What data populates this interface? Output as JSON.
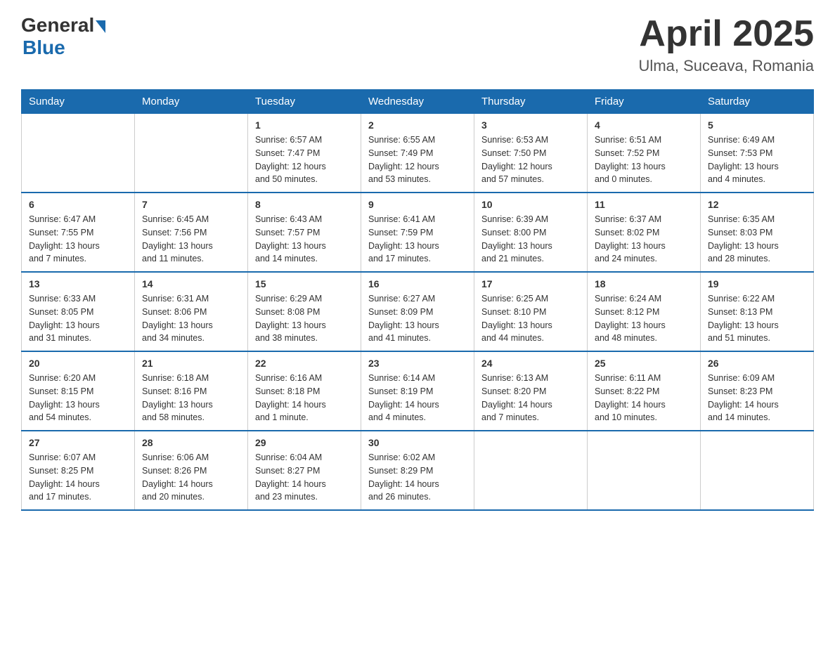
{
  "logo": {
    "general": "General",
    "blue": "Blue"
  },
  "title": "April 2025",
  "location": "Ulma, Suceava, Romania",
  "days_header": [
    "Sunday",
    "Monday",
    "Tuesday",
    "Wednesday",
    "Thursday",
    "Friday",
    "Saturday"
  ],
  "weeks": [
    [
      {
        "num": "",
        "info": ""
      },
      {
        "num": "",
        "info": ""
      },
      {
        "num": "1",
        "info": "Sunrise: 6:57 AM\nSunset: 7:47 PM\nDaylight: 12 hours\nand 50 minutes."
      },
      {
        "num": "2",
        "info": "Sunrise: 6:55 AM\nSunset: 7:49 PM\nDaylight: 12 hours\nand 53 minutes."
      },
      {
        "num": "3",
        "info": "Sunrise: 6:53 AM\nSunset: 7:50 PM\nDaylight: 12 hours\nand 57 minutes."
      },
      {
        "num": "4",
        "info": "Sunrise: 6:51 AM\nSunset: 7:52 PM\nDaylight: 13 hours\nand 0 minutes."
      },
      {
        "num": "5",
        "info": "Sunrise: 6:49 AM\nSunset: 7:53 PM\nDaylight: 13 hours\nand 4 minutes."
      }
    ],
    [
      {
        "num": "6",
        "info": "Sunrise: 6:47 AM\nSunset: 7:55 PM\nDaylight: 13 hours\nand 7 minutes."
      },
      {
        "num": "7",
        "info": "Sunrise: 6:45 AM\nSunset: 7:56 PM\nDaylight: 13 hours\nand 11 minutes."
      },
      {
        "num": "8",
        "info": "Sunrise: 6:43 AM\nSunset: 7:57 PM\nDaylight: 13 hours\nand 14 minutes."
      },
      {
        "num": "9",
        "info": "Sunrise: 6:41 AM\nSunset: 7:59 PM\nDaylight: 13 hours\nand 17 minutes."
      },
      {
        "num": "10",
        "info": "Sunrise: 6:39 AM\nSunset: 8:00 PM\nDaylight: 13 hours\nand 21 minutes."
      },
      {
        "num": "11",
        "info": "Sunrise: 6:37 AM\nSunset: 8:02 PM\nDaylight: 13 hours\nand 24 minutes."
      },
      {
        "num": "12",
        "info": "Sunrise: 6:35 AM\nSunset: 8:03 PM\nDaylight: 13 hours\nand 28 minutes."
      }
    ],
    [
      {
        "num": "13",
        "info": "Sunrise: 6:33 AM\nSunset: 8:05 PM\nDaylight: 13 hours\nand 31 minutes."
      },
      {
        "num": "14",
        "info": "Sunrise: 6:31 AM\nSunset: 8:06 PM\nDaylight: 13 hours\nand 34 minutes."
      },
      {
        "num": "15",
        "info": "Sunrise: 6:29 AM\nSunset: 8:08 PM\nDaylight: 13 hours\nand 38 minutes."
      },
      {
        "num": "16",
        "info": "Sunrise: 6:27 AM\nSunset: 8:09 PM\nDaylight: 13 hours\nand 41 minutes."
      },
      {
        "num": "17",
        "info": "Sunrise: 6:25 AM\nSunset: 8:10 PM\nDaylight: 13 hours\nand 44 minutes."
      },
      {
        "num": "18",
        "info": "Sunrise: 6:24 AM\nSunset: 8:12 PM\nDaylight: 13 hours\nand 48 minutes."
      },
      {
        "num": "19",
        "info": "Sunrise: 6:22 AM\nSunset: 8:13 PM\nDaylight: 13 hours\nand 51 minutes."
      }
    ],
    [
      {
        "num": "20",
        "info": "Sunrise: 6:20 AM\nSunset: 8:15 PM\nDaylight: 13 hours\nand 54 minutes."
      },
      {
        "num": "21",
        "info": "Sunrise: 6:18 AM\nSunset: 8:16 PM\nDaylight: 13 hours\nand 58 minutes."
      },
      {
        "num": "22",
        "info": "Sunrise: 6:16 AM\nSunset: 8:18 PM\nDaylight: 14 hours\nand 1 minute."
      },
      {
        "num": "23",
        "info": "Sunrise: 6:14 AM\nSunset: 8:19 PM\nDaylight: 14 hours\nand 4 minutes."
      },
      {
        "num": "24",
        "info": "Sunrise: 6:13 AM\nSunset: 8:20 PM\nDaylight: 14 hours\nand 7 minutes."
      },
      {
        "num": "25",
        "info": "Sunrise: 6:11 AM\nSunset: 8:22 PM\nDaylight: 14 hours\nand 10 minutes."
      },
      {
        "num": "26",
        "info": "Sunrise: 6:09 AM\nSunset: 8:23 PM\nDaylight: 14 hours\nand 14 minutes."
      }
    ],
    [
      {
        "num": "27",
        "info": "Sunrise: 6:07 AM\nSunset: 8:25 PM\nDaylight: 14 hours\nand 17 minutes."
      },
      {
        "num": "28",
        "info": "Sunrise: 6:06 AM\nSunset: 8:26 PM\nDaylight: 14 hours\nand 20 minutes."
      },
      {
        "num": "29",
        "info": "Sunrise: 6:04 AM\nSunset: 8:27 PM\nDaylight: 14 hours\nand 23 minutes."
      },
      {
        "num": "30",
        "info": "Sunrise: 6:02 AM\nSunset: 8:29 PM\nDaylight: 14 hours\nand 26 minutes."
      },
      {
        "num": "",
        "info": ""
      },
      {
        "num": "",
        "info": ""
      },
      {
        "num": "",
        "info": ""
      }
    ]
  ]
}
